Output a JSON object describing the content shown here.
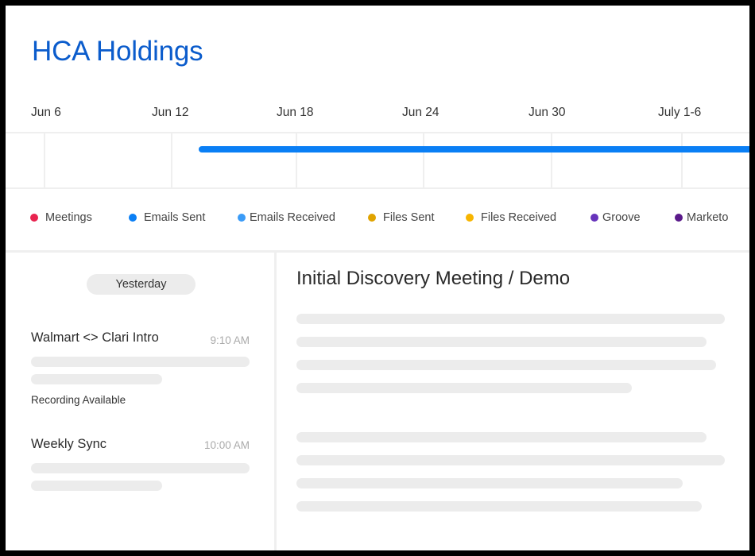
{
  "header": {
    "title": "HCA Holdings"
  },
  "timeline": {
    "ticks": [
      "Jun 6",
      "Jun 12",
      "Jun 18",
      "Jun 24",
      "Jun 30",
      "July 1-6"
    ],
    "activity_bar": {
      "start": "Jun 13",
      "end": "beyond July 1-6",
      "color": "#0a7ff5"
    }
  },
  "legend": [
    {
      "label": "Meetings",
      "color": "#e8234f"
    },
    {
      "label": "Emails Sent",
      "color": "#0a7ff5"
    },
    {
      "label": "Emails Received",
      "color": "#3a9bf7"
    },
    {
      "label": "Files Sent",
      "color": "#e0a300"
    },
    {
      "label": "Files Received",
      "color": "#f7b500"
    },
    {
      "label": "Groove",
      "color": "#6633bb"
    },
    {
      "label": "Marketo",
      "color": "#5a1a8a"
    }
  ],
  "activity_list": {
    "date_pill": "Yesterday",
    "items": [
      {
        "title": "Walmart <> Clari Intro",
        "time": "9:10 AM",
        "note": "Recording Available"
      },
      {
        "title": "Weekly Sync",
        "time": "10:00 AM"
      }
    ]
  },
  "detail": {
    "title": "Initial Discovery Meeting / Demo"
  }
}
